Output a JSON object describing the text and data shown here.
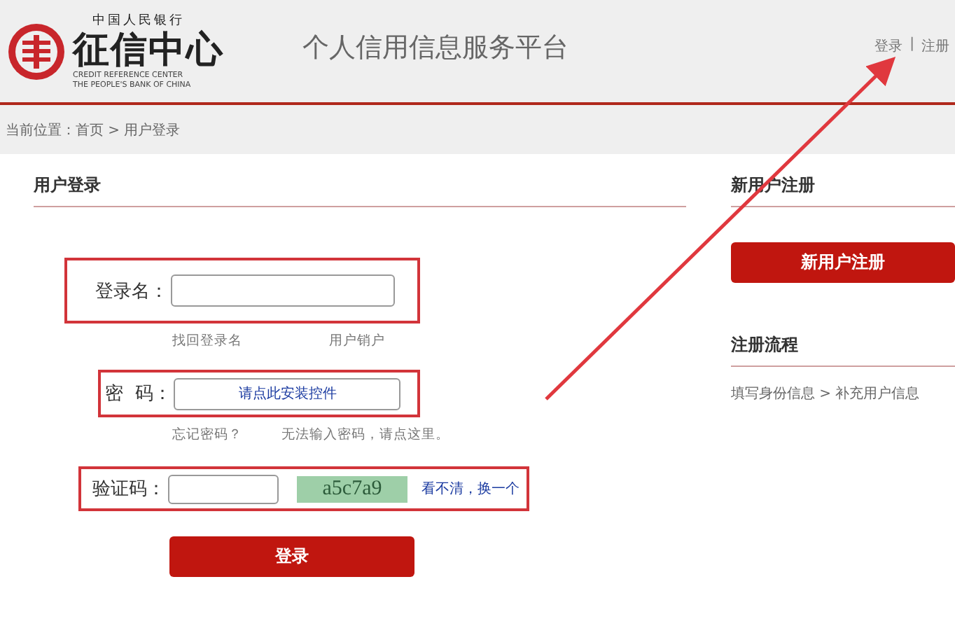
{
  "header": {
    "logo": {
      "bank": "中国人民银行",
      "name": "征信中心",
      "english_1": "CREDIT REFERENCE CENTER",
      "english_2": "THE PEOPLE'S BANK OF CHINA"
    },
    "title": "个人信用信息服务平台",
    "links": [
      "登录",
      "|",
      "注册"
    ]
  },
  "breadcrumb": "当前位置：首页 > 用户登录",
  "login": {
    "heading": "用户登录",
    "rows": [
      {
        "kind": "text",
        "label": "登录名：",
        "links": [
          "找回登录名",
          "用户销户"
        ]
      },
      {
        "kind": "control",
        "label": "密  码：",
        "value": "请点此安装控件",
        "links": [
          "忘记密码？",
          "无法输入密码，请点这里。"
        ]
      },
      {
        "kind": "captcha",
        "label": "验证码：",
        "captcha": "a5c7a9",
        "refresh": "看不清，换一个"
      }
    ],
    "button": "登录"
  },
  "register": {
    "heading": "新用户注册",
    "button": "新用户注册",
    "process_heading": "注册流程",
    "process": "填写身份信息 > 补充用户信息"
  }
}
